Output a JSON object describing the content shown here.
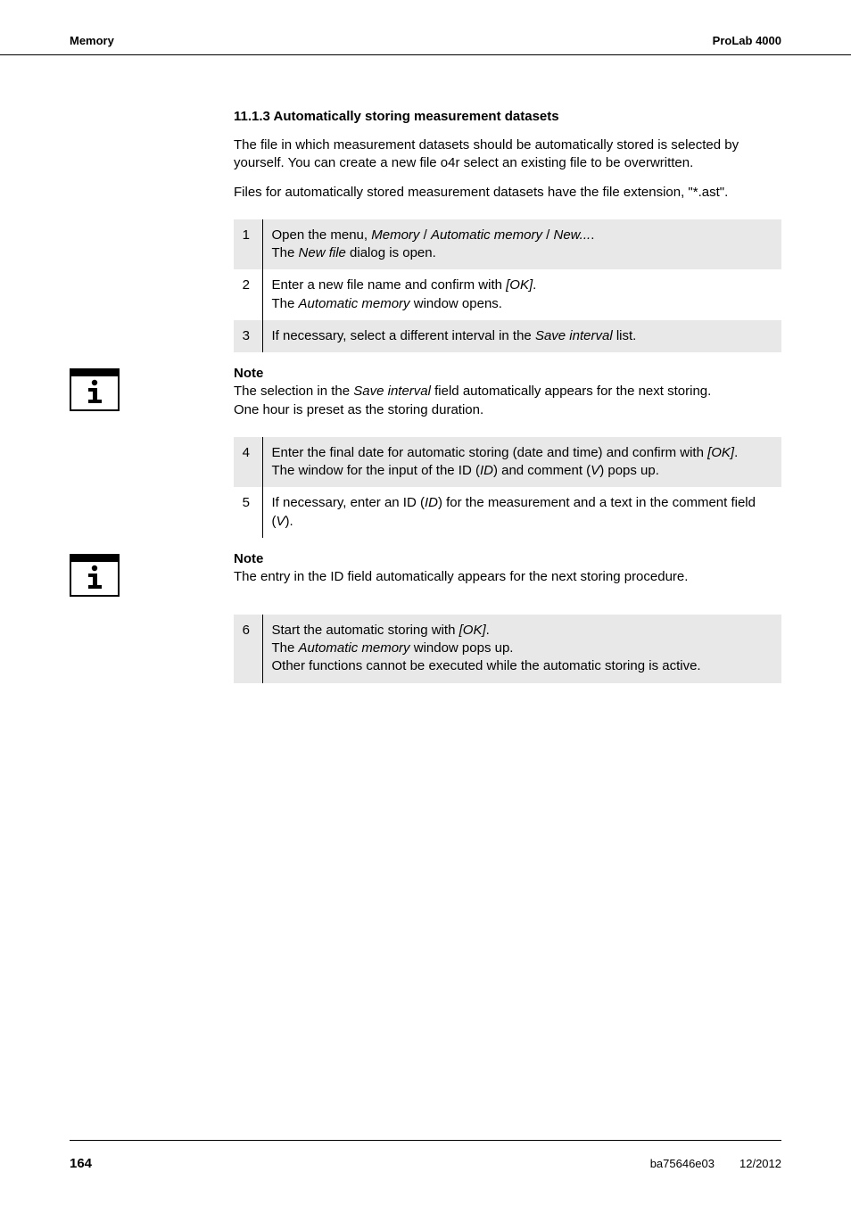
{
  "header": {
    "left": "Memory",
    "right": "ProLab 4000"
  },
  "section": {
    "number": "11.1.3",
    "title": "Automatically storing measurement datasets"
  },
  "intro": {
    "p1": "The file in which measurement datasets should be automatically stored is selected by yourself. You can create a new file o4r select an existing file to be overwritten.",
    "p2": "Files for automatically stored measurement datasets have the file extension, \"*.ast\"."
  },
  "steps1": [
    {
      "num": "1",
      "lines": [
        {
          "prefix": "Open the menu, ",
          "italic": "Memory",
          "mid": " / ",
          "italic2": "Automatic memory",
          "mid2": " / ",
          "italic3": "New...",
          "suffix": "."
        },
        {
          "prefix": "The ",
          "italic": "New file",
          "suffix": " dialog is open."
        }
      ]
    },
    {
      "num": "2",
      "lines": [
        {
          "prefix": "Enter a new file name and confirm with ",
          "italic": "[OK]",
          "suffix": "."
        },
        {
          "prefix": "The ",
          "italic": "Automatic memory",
          "suffix": " window opens."
        }
      ]
    },
    {
      "num": "3",
      "lines": [
        {
          "prefix": "If necessary, select a different interval in the ",
          "italic": "Save interval",
          "suffix": " list."
        }
      ]
    }
  ],
  "note1": {
    "label": "Note",
    "l1_a": "The selection in the ",
    "l1_i": "Save interval",
    "l1_b": " field automatically appears for the next storing.",
    "l2": "One hour is preset as the storing duration."
  },
  "steps2": [
    {
      "num": "4",
      "lines": [
        {
          "prefix": "Enter the final date for automatic storing (date and time) and confirm with ",
          "italic": "[OK]",
          "suffix": "."
        },
        {
          "prefix": "The window for the input of the ID (",
          "italic": "ID",
          "mid": ") and comment (",
          "italic2": "V",
          "suffix": ") pops up."
        }
      ]
    },
    {
      "num": "5",
      "lines": [
        {
          "prefix": "If necessary, enter an ID (",
          "italic": "ID",
          "mid": ") for the measurement and a text in the comment field (",
          "italic2": "V",
          "suffix": ")."
        }
      ]
    }
  ],
  "note2": {
    "label": "Note",
    "text": "The entry in the ID field automatically appears for the next storing procedure."
  },
  "steps3": [
    {
      "num": "6",
      "lines": [
        {
          "prefix": "Start the automatic storing with ",
          "italic": "[OK]",
          "suffix": "."
        },
        {
          "prefix": "The ",
          "italic": "Automatic memory",
          "suffix": " window pops up."
        },
        {
          "plain": "Other functions cannot be executed while the automatic storing is active."
        }
      ]
    }
  ],
  "footer": {
    "page": "164",
    "docid": "ba75646e03",
    "date": "12/2012"
  }
}
